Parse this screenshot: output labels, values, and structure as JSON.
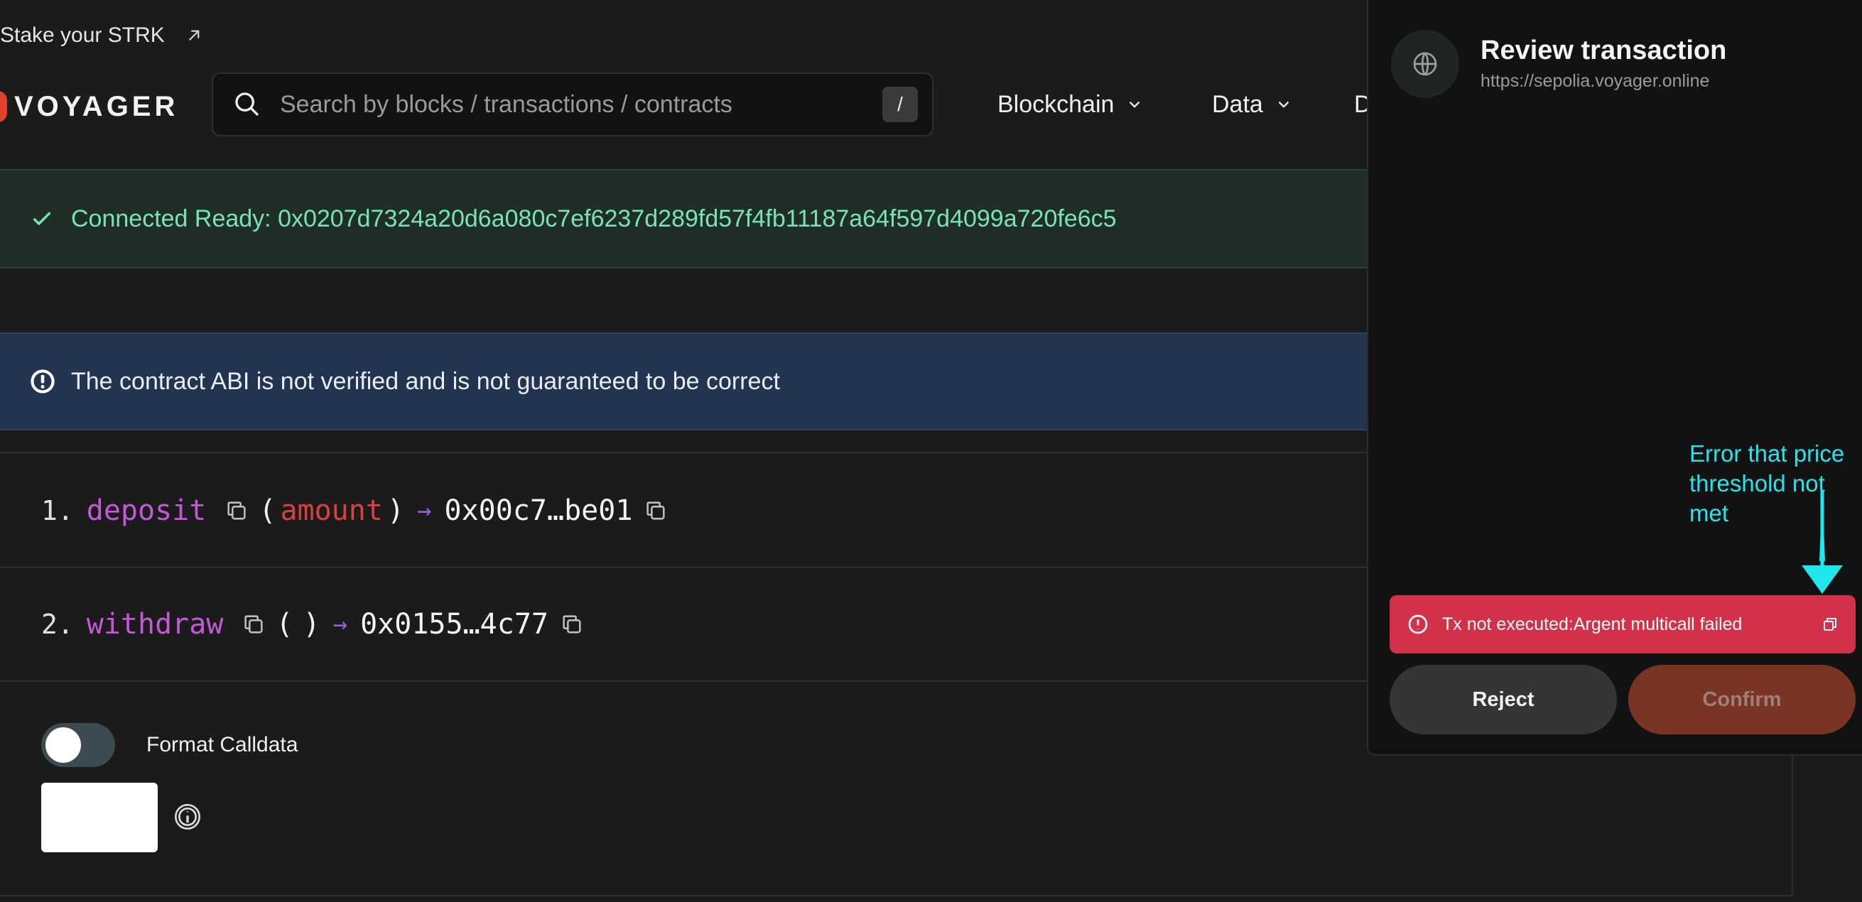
{
  "promo": {
    "text": "Stake your STRK"
  },
  "header": {
    "logo_text": "VOYAGER",
    "search_placeholder": "Search by blocks / transactions / contracts",
    "search_shortcut": "/",
    "nav": [
      {
        "label": "Blockchain"
      },
      {
        "label": "Data"
      },
      {
        "label": "D"
      }
    ]
  },
  "banners": {
    "connected": "Connected Ready: 0x0207d7324a20d6a080c7ef6237d289fd57f4fb11187a64f597d4099a720fe6c5",
    "abi_warning": "The contract ABI is not verified and is not guaranteed to be correct"
  },
  "functions": [
    {
      "number": "1.",
      "name": "deposit",
      "open": "(",
      "param": "amount",
      "close": ")",
      "arrow": "→",
      "address": "0x00c7…be01"
    },
    {
      "number": "2.",
      "name": "withdraw",
      "open": "(",
      "param": "",
      "close": ")",
      "arrow": "→",
      "address": "0x0155…4c77"
    }
  ],
  "format_calldata": {
    "label": "Format Calldata",
    "enabled": false
  },
  "popup": {
    "title": "Review transaction",
    "url": "https://sepolia.voyager.online",
    "error": "Tx not executed:Argent multicall failed",
    "reject_label": "Reject",
    "confirm_label": "Confirm"
  },
  "annotation": {
    "text": "Error that price threshold not met",
    "color": "#22e6ee"
  },
  "colors": {
    "function_name": "#c259d6",
    "param": "#d8423d",
    "connected_text": "#79e2b8",
    "error_bg": "#d3314a",
    "confirm_bg": "#7a3424"
  }
}
